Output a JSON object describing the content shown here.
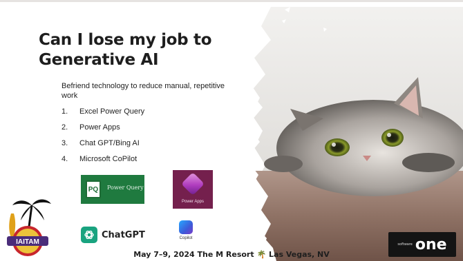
{
  "slide": {
    "title": "Can I lose my job to Generative AI",
    "subtitle": "Befriend technology to reduce manual, repetitive work",
    "list": [
      {
        "num": "1.",
        "label": "Excel Power Query"
      },
      {
        "num": "2.",
        "label": "Power Apps"
      },
      {
        "num": "3.",
        "label": "Chat GPT/Bing AI"
      },
      {
        "num": "4.",
        "label": "Microsoft CoPilot"
      }
    ]
  },
  "logos": {
    "power_query": {
      "badge": "PQ",
      "label": "Power Query",
      "icon": "power-query-icon"
    },
    "power_apps": {
      "label": "Power Apps",
      "icon": "power-apps-icon"
    },
    "chatgpt": {
      "label": "ChatGPT",
      "icon": "chatgpt-icon"
    },
    "copilot": {
      "label": "Copilot",
      "icon": "copilot-icon"
    }
  },
  "footer": {
    "date_venue": "May 7–9, 2024  The M Resort",
    "palm_glyph": "🌴",
    "city": "Las Vegas, NV"
  },
  "emblem": {
    "label": "IAITAM"
  },
  "sponsor": {
    "small": "software",
    "big": "one"
  },
  "colors": {
    "title": "#1e1e1e",
    "power_query_bg": "#1f7a3f",
    "power_apps_bg": "#74204d",
    "chatgpt_green": "#19a37f"
  }
}
